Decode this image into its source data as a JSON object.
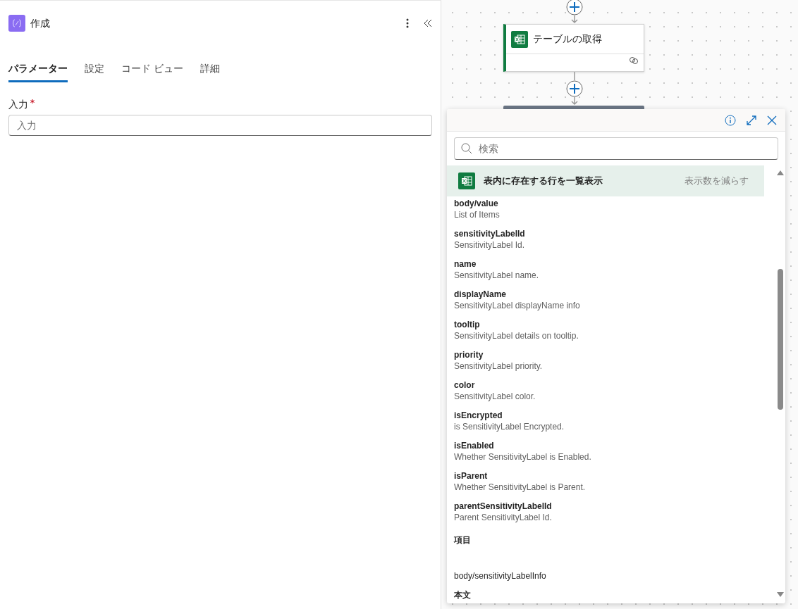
{
  "panel": {
    "title": "作成",
    "tabs": [
      {
        "label": "パラメーター",
        "selected": true
      },
      {
        "label": "設定",
        "selected": false
      },
      {
        "label": "コード ビュー",
        "selected": false
      },
      {
        "label": "詳細",
        "selected": false
      }
    ],
    "field": {
      "label": "入力",
      "required": true,
      "placeholder": "入力"
    }
  },
  "canvas": {
    "node": {
      "title": "テーブルの取得"
    }
  },
  "picker": {
    "search": {
      "placeholder": "検索"
    },
    "group": {
      "title": "表内に存在する行を一覧表示",
      "action": "表示数を減らす"
    },
    "items": [
      {
        "kind": "field",
        "name": "body/value",
        "description": "List of Items"
      },
      {
        "kind": "field",
        "name": "sensitivityLabelId",
        "description": "SensitivityLabel Id."
      },
      {
        "kind": "field",
        "name": "name",
        "description": "SensitivityLabel name."
      },
      {
        "kind": "field",
        "name": "displayName",
        "description": "SensitivityLabel displayName info"
      },
      {
        "kind": "field",
        "name": "tooltip",
        "description": "SensitivityLabel details on tooltip."
      },
      {
        "kind": "field",
        "name": "priority",
        "description": "SensitivityLabel priority."
      },
      {
        "kind": "field",
        "name": "color",
        "description": "SensitivityLabel color."
      },
      {
        "kind": "field",
        "name": "isEncrypted",
        "description": "is SensitivityLabel Encrypted."
      },
      {
        "kind": "field",
        "name": "isEnabled",
        "description": "Whether SensitivityLabel is Enabled."
      },
      {
        "kind": "field",
        "name": "isParent",
        "description": "Whether SensitivityLabel is Parent."
      },
      {
        "kind": "field",
        "name": "parentSensitivityLabelId",
        "description": "Parent SensitivityLabel Id."
      },
      {
        "kind": "heading",
        "name": "項目"
      },
      {
        "kind": "plain",
        "name": "body/sensitivityLabelInfo"
      },
      {
        "kind": "heading",
        "name": "本文"
      }
    ]
  }
}
